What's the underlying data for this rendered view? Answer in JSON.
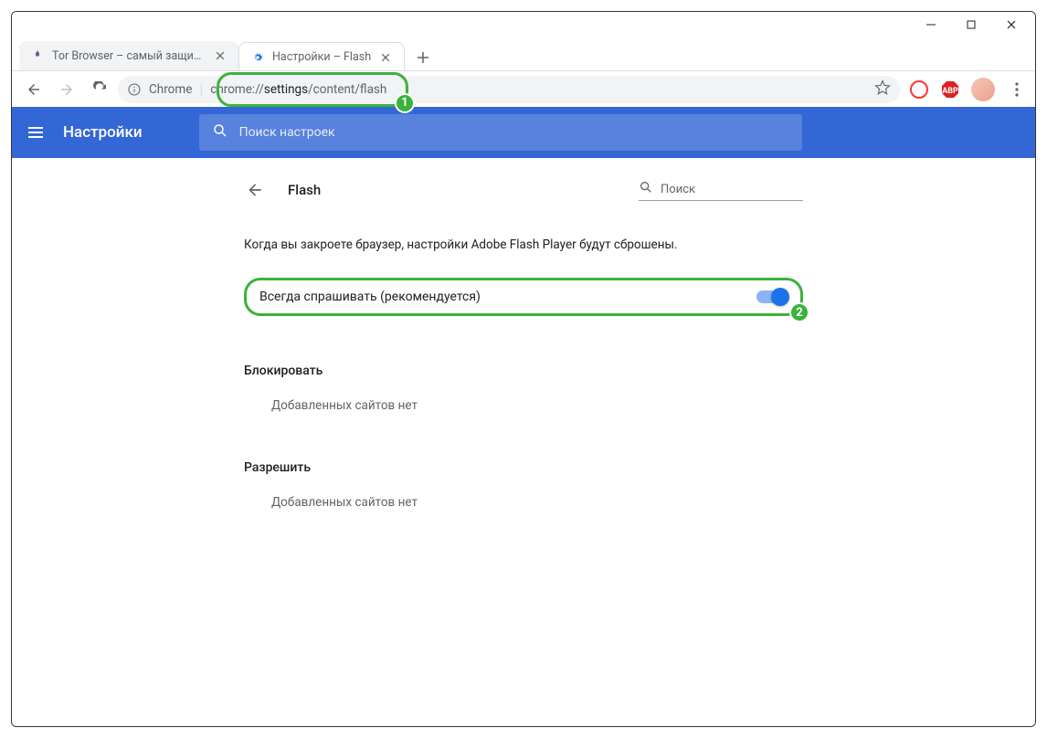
{
  "tabs": [
    {
      "title": "Tor Browser – самый защищенн…",
      "active": false,
      "favicon": "onion"
    },
    {
      "title": "Настройки – Flash",
      "active": true,
      "favicon": "gear-blue"
    }
  ],
  "toolbar": {
    "url_prefix": "Chrome",
    "url_scheme": "chrome://",
    "url_hl": "settings",
    "url_rest": "/content/flash"
  },
  "annotations": {
    "badge1": "1",
    "badge2": "2"
  },
  "header": {
    "title": "Настройки",
    "search_placeholder": "Поиск настроек"
  },
  "section": {
    "title": "Flash",
    "local_search_placeholder": "Поиск",
    "description": "Когда вы закроете браузер, настройки Adobe Flash Player будут сброшены.",
    "toggle_label": "Всегда спрашивать (рекомендуется)",
    "block_heading": "Блокировать",
    "block_empty": "Добавленных сайтов нет",
    "allow_heading": "Разрешить",
    "allow_empty": "Добавленных сайтов нет"
  }
}
